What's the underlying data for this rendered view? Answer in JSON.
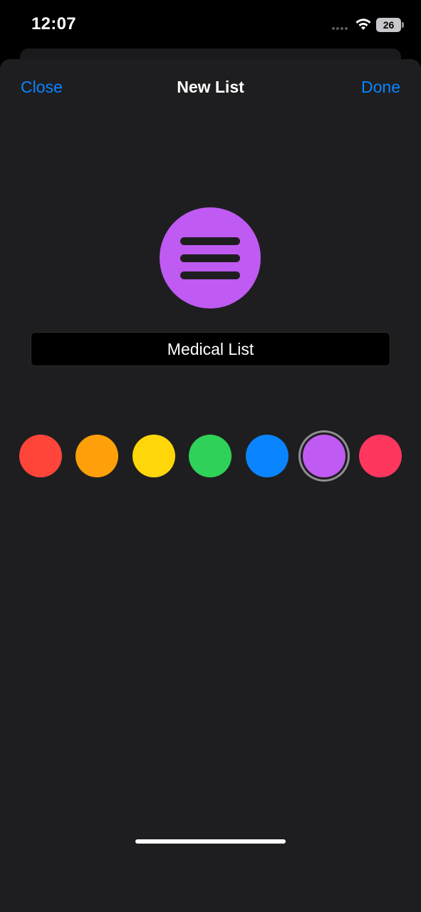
{
  "status_bar": {
    "time": "12:07",
    "battery": "26"
  },
  "nav": {
    "close_label": "Close",
    "title": "New List",
    "done_label": "Done"
  },
  "list": {
    "icon": "list-bullet-icon",
    "icon_color": "#bf5af2",
    "name": "Medical List"
  },
  "colors": [
    {
      "name": "red",
      "hex": "#ff453a",
      "selected": false
    },
    {
      "name": "orange",
      "hex": "#ff9f0a",
      "selected": false
    },
    {
      "name": "yellow",
      "hex": "#ffd60a",
      "selected": false
    },
    {
      "name": "green",
      "hex": "#30d158",
      "selected": false
    },
    {
      "name": "blue",
      "hex": "#0a84ff",
      "selected": false
    },
    {
      "name": "purple",
      "hex": "#bf5af2",
      "selected": true
    },
    {
      "name": "pink",
      "hex": "#ff375f",
      "selected": false
    }
  ]
}
